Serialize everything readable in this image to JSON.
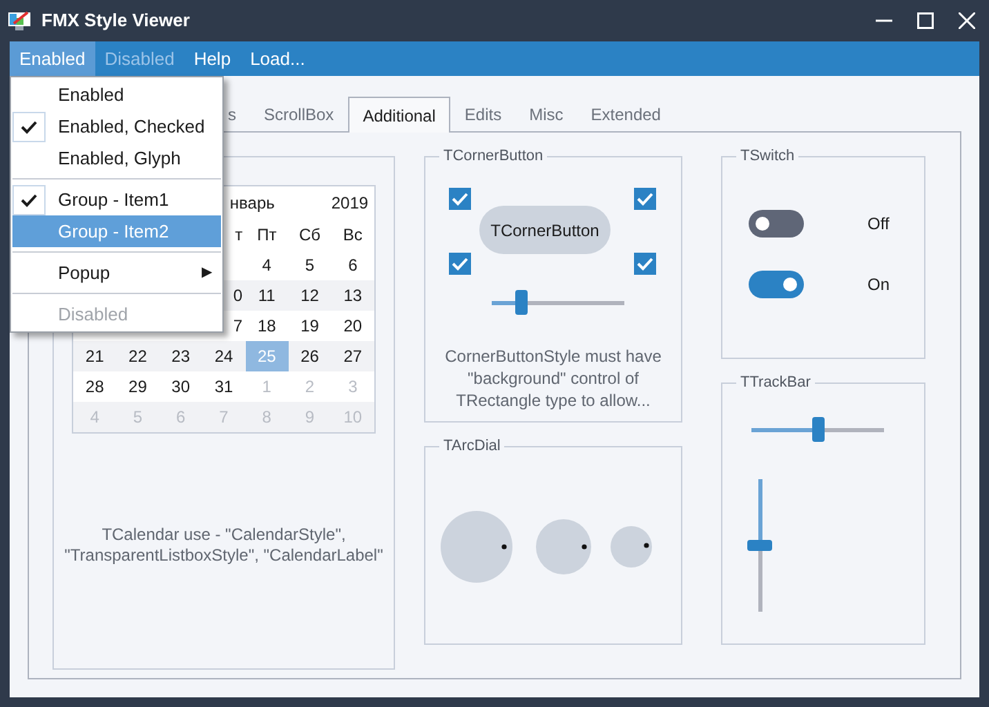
{
  "window": {
    "title": "FMX Style Viewer"
  },
  "menu_bar": [
    {
      "label": "Enabled",
      "selected": true,
      "disabled": false
    },
    {
      "label": "Disabled",
      "selected": false,
      "disabled": true
    },
    {
      "label": "Help",
      "selected": false,
      "disabled": false
    },
    {
      "label": "Load...",
      "selected": false,
      "disabled": false
    }
  ],
  "popup_menu": [
    {
      "kind": "item",
      "label": "Enabled",
      "checked": false,
      "selected": false,
      "disabled": false
    },
    {
      "kind": "item",
      "label": "Enabled, Checked",
      "checked": true,
      "selected": false,
      "disabled": false
    },
    {
      "kind": "item",
      "label": "Enabled, Glyph",
      "checked": false,
      "selected": false,
      "disabled": false
    },
    {
      "kind": "separator"
    },
    {
      "kind": "item",
      "label": "Group - Item1",
      "checked": true,
      "selected": false,
      "disabled": false
    },
    {
      "kind": "item",
      "label": "Group - Item2",
      "checked": false,
      "selected": true,
      "disabled": false
    },
    {
      "kind": "separator"
    },
    {
      "kind": "submenu",
      "label": "Popup",
      "arrow": "▶",
      "checked": false,
      "selected": false,
      "disabled": false
    },
    {
      "kind": "separator"
    },
    {
      "kind": "item",
      "label": "Disabled",
      "checked": false,
      "selected": false,
      "disabled": true
    }
  ],
  "tabs": [
    {
      "label": "s",
      "selected": false
    },
    {
      "label": "ScrollBox",
      "selected": false
    },
    {
      "label": "Additional",
      "selected": true
    },
    {
      "label": "Edits",
      "selected": false
    },
    {
      "label": "Misc",
      "selected": false
    },
    {
      "label": "Extended",
      "selected": false
    }
  ],
  "calendar": {
    "month": "нварь",
    "year": "2019",
    "weekdays": [
      {
        "label": "т",
        "clipped": true
      },
      {
        "label": "Пт",
        "clipped": false
      },
      {
        "label": "Сб",
        "clipped": false
      },
      {
        "label": "Вс",
        "clipped": false
      }
    ],
    "weeks": [
      [
        {
          "day": "4",
          "selected": false,
          "other_month": false,
          "clipped": false
        },
        {
          "day": "5",
          "selected": false,
          "other_month": false,
          "clipped": false
        },
        {
          "day": "6",
          "selected": false,
          "other_month": false,
          "clipped": false
        }
      ],
      [
        {
          "day": "0",
          "selected": false,
          "other_month": false,
          "clipped": true
        },
        {
          "day": "11",
          "selected": false,
          "other_month": false,
          "clipped": false
        },
        {
          "day": "12",
          "selected": false,
          "other_month": false,
          "clipped": false
        },
        {
          "day": "13",
          "selected": false,
          "other_month": false,
          "clipped": false
        }
      ],
      [
        {
          "day": "7",
          "selected": false,
          "other_month": false,
          "clipped": true
        },
        {
          "day": "18",
          "selected": false,
          "other_month": false,
          "clipped": false
        },
        {
          "day": "19",
          "selected": false,
          "other_month": false,
          "clipped": false
        },
        {
          "day": "20",
          "selected": false,
          "other_month": false,
          "clipped": false
        }
      ],
      [
        {
          "day": "21",
          "selected": false,
          "other_month": false,
          "clipped": false
        },
        {
          "day": "22",
          "selected": false,
          "other_month": false,
          "clipped": false
        },
        {
          "day": "23",
          "selected": false,
          "other_month": false,
          "clipped": false
        },
        {
          "day": "24",
          "selected": false,
          "other_month": false,
          "clipped": false
        },
        {
          "day": "25",
          "selected": true,
          "other_month": false,
          "clipped": false
        },
        {
          "day": "26",
          "selected": false,
          "other_month": false,
          "clipped": false
        },
        {
          "day": "27",
          "selected": false,
          "other_month": false,
          "clipped": false
        }
      ],
      [
        {
          "day": "28",
          "selected": false,
          "other_month": false,
          "clipped": false
        },
        {
          "day": "29",
          "selected": false,
          "other_month": false,
          "clipped": false
        },
        {
          "day": "30",
          "selected": false,
          "other_month": false,
          "clipped": false
        },
        {
          "day": "31",
          "selected": false,
          "other_month": false,
          "clipped": false
        },
        {
          "day": "1",
          "selected": false,
          "other_month": true,
          "clipped": false
        },
        {
          "day": "2",
          "selected": false,
          "other_month": true,
          "clipped": false
        },
        {
          "day": "3",
          "selected": false,
          "other_month": true,
          "clipped": false
        }
      ],
      [
        {
          "day": "4",
          "selected": false,
          "other_month": true,
          "clipped": false
        },
        {
          "day": "5",
          "selected": false,
          "other_month": true,
          "clipped": false
        },
        {
          "day": "6",
          "selected": false,
          "other_month": true,
          "clipped": false
        },
        {
          "day": "7",
          "selected": false,
          "other_month": true,
          "clipped": false
        },
        {
          "day": "8",
          "selected": false,
          "other_month": true,
          "clipped": false
        },
        {
          "day": "9",
          "selected": false,
          "other_month": true,
          "clipped": false
        },
        {
          "day": "10",
          "selected": false,
          "other_month": true,
          "clipped": false
        }
      ]
    ],
    "caption": "TCalendar use - \"CalendarStyle\", \"TransparentListboxStyle\", \"CalendarLabel\""
  },
  "corner_button_group": {
    "title": "TCornerButton",
    "checkboxes": [
      {
        "checked": true
      },
      {
        "checked": true
      },
      {
        "checked": true
      },
      {
        "checked": true
      }
    ],
    "button": "TCornerButton",
    "slider": {
      "level": 0.19
    },
    "caption": "CornerButtonStyle must have \"background\" control of TRectangle type to allow..."
  },
  "arc_dial_group": {
    "title": "TArcDial"
  },
  "switch_group": {
    "title": "TSwitch",
    "switches": [
      {
        "on": false,
        "label": "Off"
      },
      {
        "on": true,
        "label": "On"
      }
    ]
  },
  "trackbar_group": {
    "title": "TTrackBar",
    "horizontal": {
      "level": 0.5
    },
    "vertical": {
      "level": 0.5
    }
  }
}
